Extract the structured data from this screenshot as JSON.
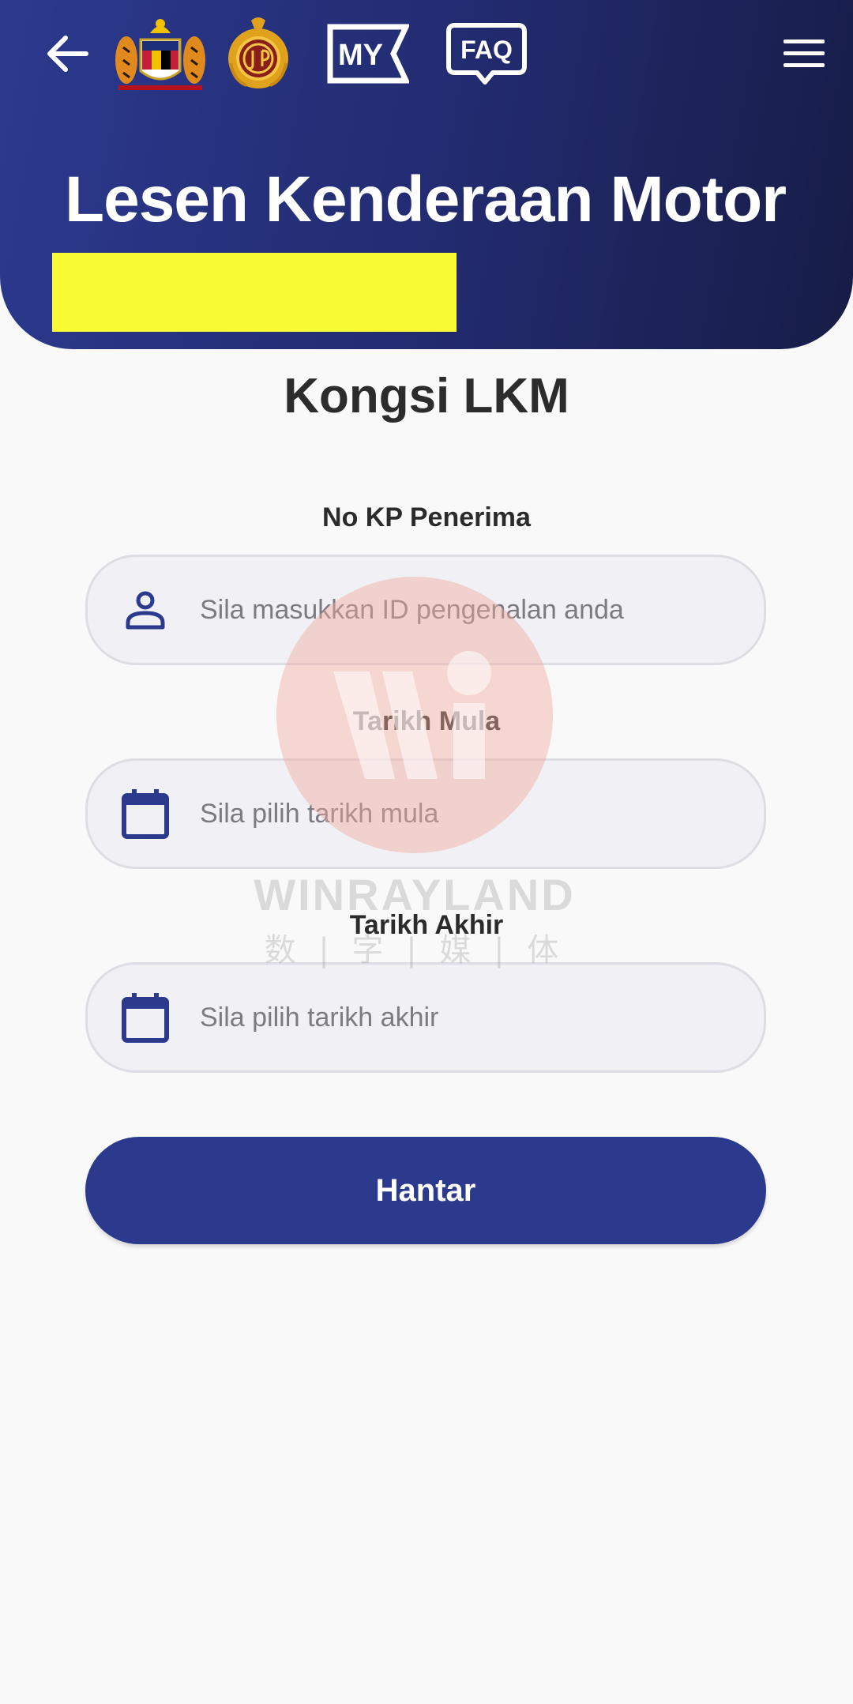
{
  "header": {
    "title": "Lesen Kenderaan Motor",
    "back_icon": "arrow-left-icon",
    "crest_icon": "malaysia-coat-of-arms-icon",
    "jpj_icon": "jpj-logo-icon",
    "my_label": "MY",
    "faq_label": "FAQ",
    "menu_icon": "hamburger-menu-icon",
    "highlight_color": "#f8fb33"
  },
  "page": {
    "title": "Kongsi LKM"
  },
  "form": {
    "fields": [
      {
        "label": "No KP Penerima",
        "placeholder": "Sila masukkan ID pengenalan anda",
        "value": "",
        "icon": "user-icon"
      },
      {
        "label": "Tarikh Mula",
        "placeholder": "Sila pilih tarikh mula",
        "value": "",
        "icon": "calendar-icon"
      },
      {
        "label": "Tarikh Akhir",
        "placeholder": "Sila pilih tarikh akhir",
        "value": "",
        "icon": "calendar-icon"
      }
    ],
    "submit_label": "Hantar"
  },
  "watermark": {
    "text": "WINRAYLAND",
    "sub": "数 | 字 | 媒 | 体"
  },
  "colors": {
    "primary": "#2c3a8e",
    "header_dark": "#171c46",
    "background": "#f9f9fa",
    "field_bg": "#f1f1f5"
  }
}
